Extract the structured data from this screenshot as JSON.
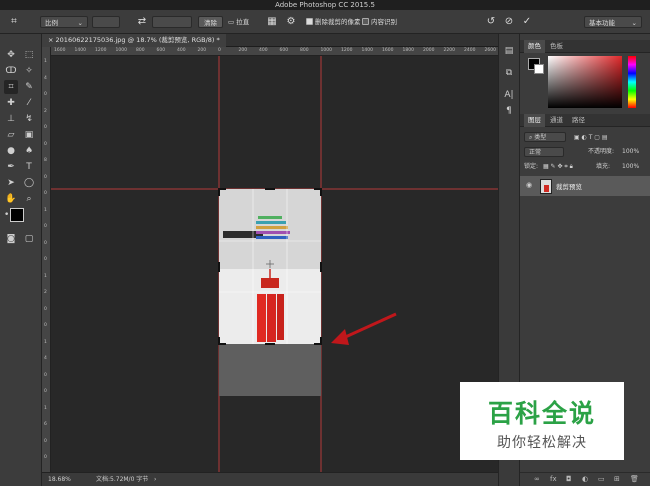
{
  "window": {
    "title": "Adobe Photoshop CC 2015.5"
  },
  "options_bar": {
    "ratio_label": "比例",
    "clear_label": "清除",
    "straighten_label": "拉直",
    "delete_cropped_label": "删除裁剪的像素",
    "delete_cropped_checked": true,
    "content_aware_label": "内容识别",
    "content_aware_checked": false,
    "workspace_label": "基本功能"
  },
  "document": {
    "tab_title": "20160622175036.jpg @ 18.7% (裁剪预览, RGB/8) *",
    "ruler_h": [
      "1600",
      "1400",
      "1200",
      "1000",
      "800",
      "600",
      "400",
      "200",
      "0",
      "200",
      "400",
      "600",
      "800",
      "1000",
      "1200",
      "1400",
      "1600",
      "1800",
      "2000",
      "2200",
      "2400",
      "2600",
      "2800"
    ],
    "ruler_v": [
      "1",
      "4",
      "0",
      "2",
      "0",
      "0",
      "8",
      "0",
      "0",
      "1",
      "0",
      "0",
      "0",
      "1",
      "2",
      "0",
      "0",
      "1",
      "4",
      "0",
      "0",
      "1",
      "6",
      "0",
      "0"
    ]
  },
  "status_bar": {
    "zoom": "18.68%",
    "doc_info": "文档:5.72M/0 字节"
  },
  "panels": {
    "color_tabs": [
      "颜色",
      "色板"
    ],
    "layer_tabs": [
      "图层",
      "通道",
      "路径"
    ],
    "filter_label": "类型",
    "blend_mode": "正常",
    "opacity_label": "不透明度:",
    "opacity_value": "100%",
    "lock_label": "锁定:",
    "fill_label": "填充:",
    "fill_value": "100%",
    "layer_name": "裁剪预览"
  },
  "watermark": {
    "line1": "百科全说",
    "line2": "助你轻松解决"
  },
  "colors": {
    "accent_guide": "#c0403f",
    "arrow": "#c0171b",
    "watermark_green": "#2ba246"
  }
}
